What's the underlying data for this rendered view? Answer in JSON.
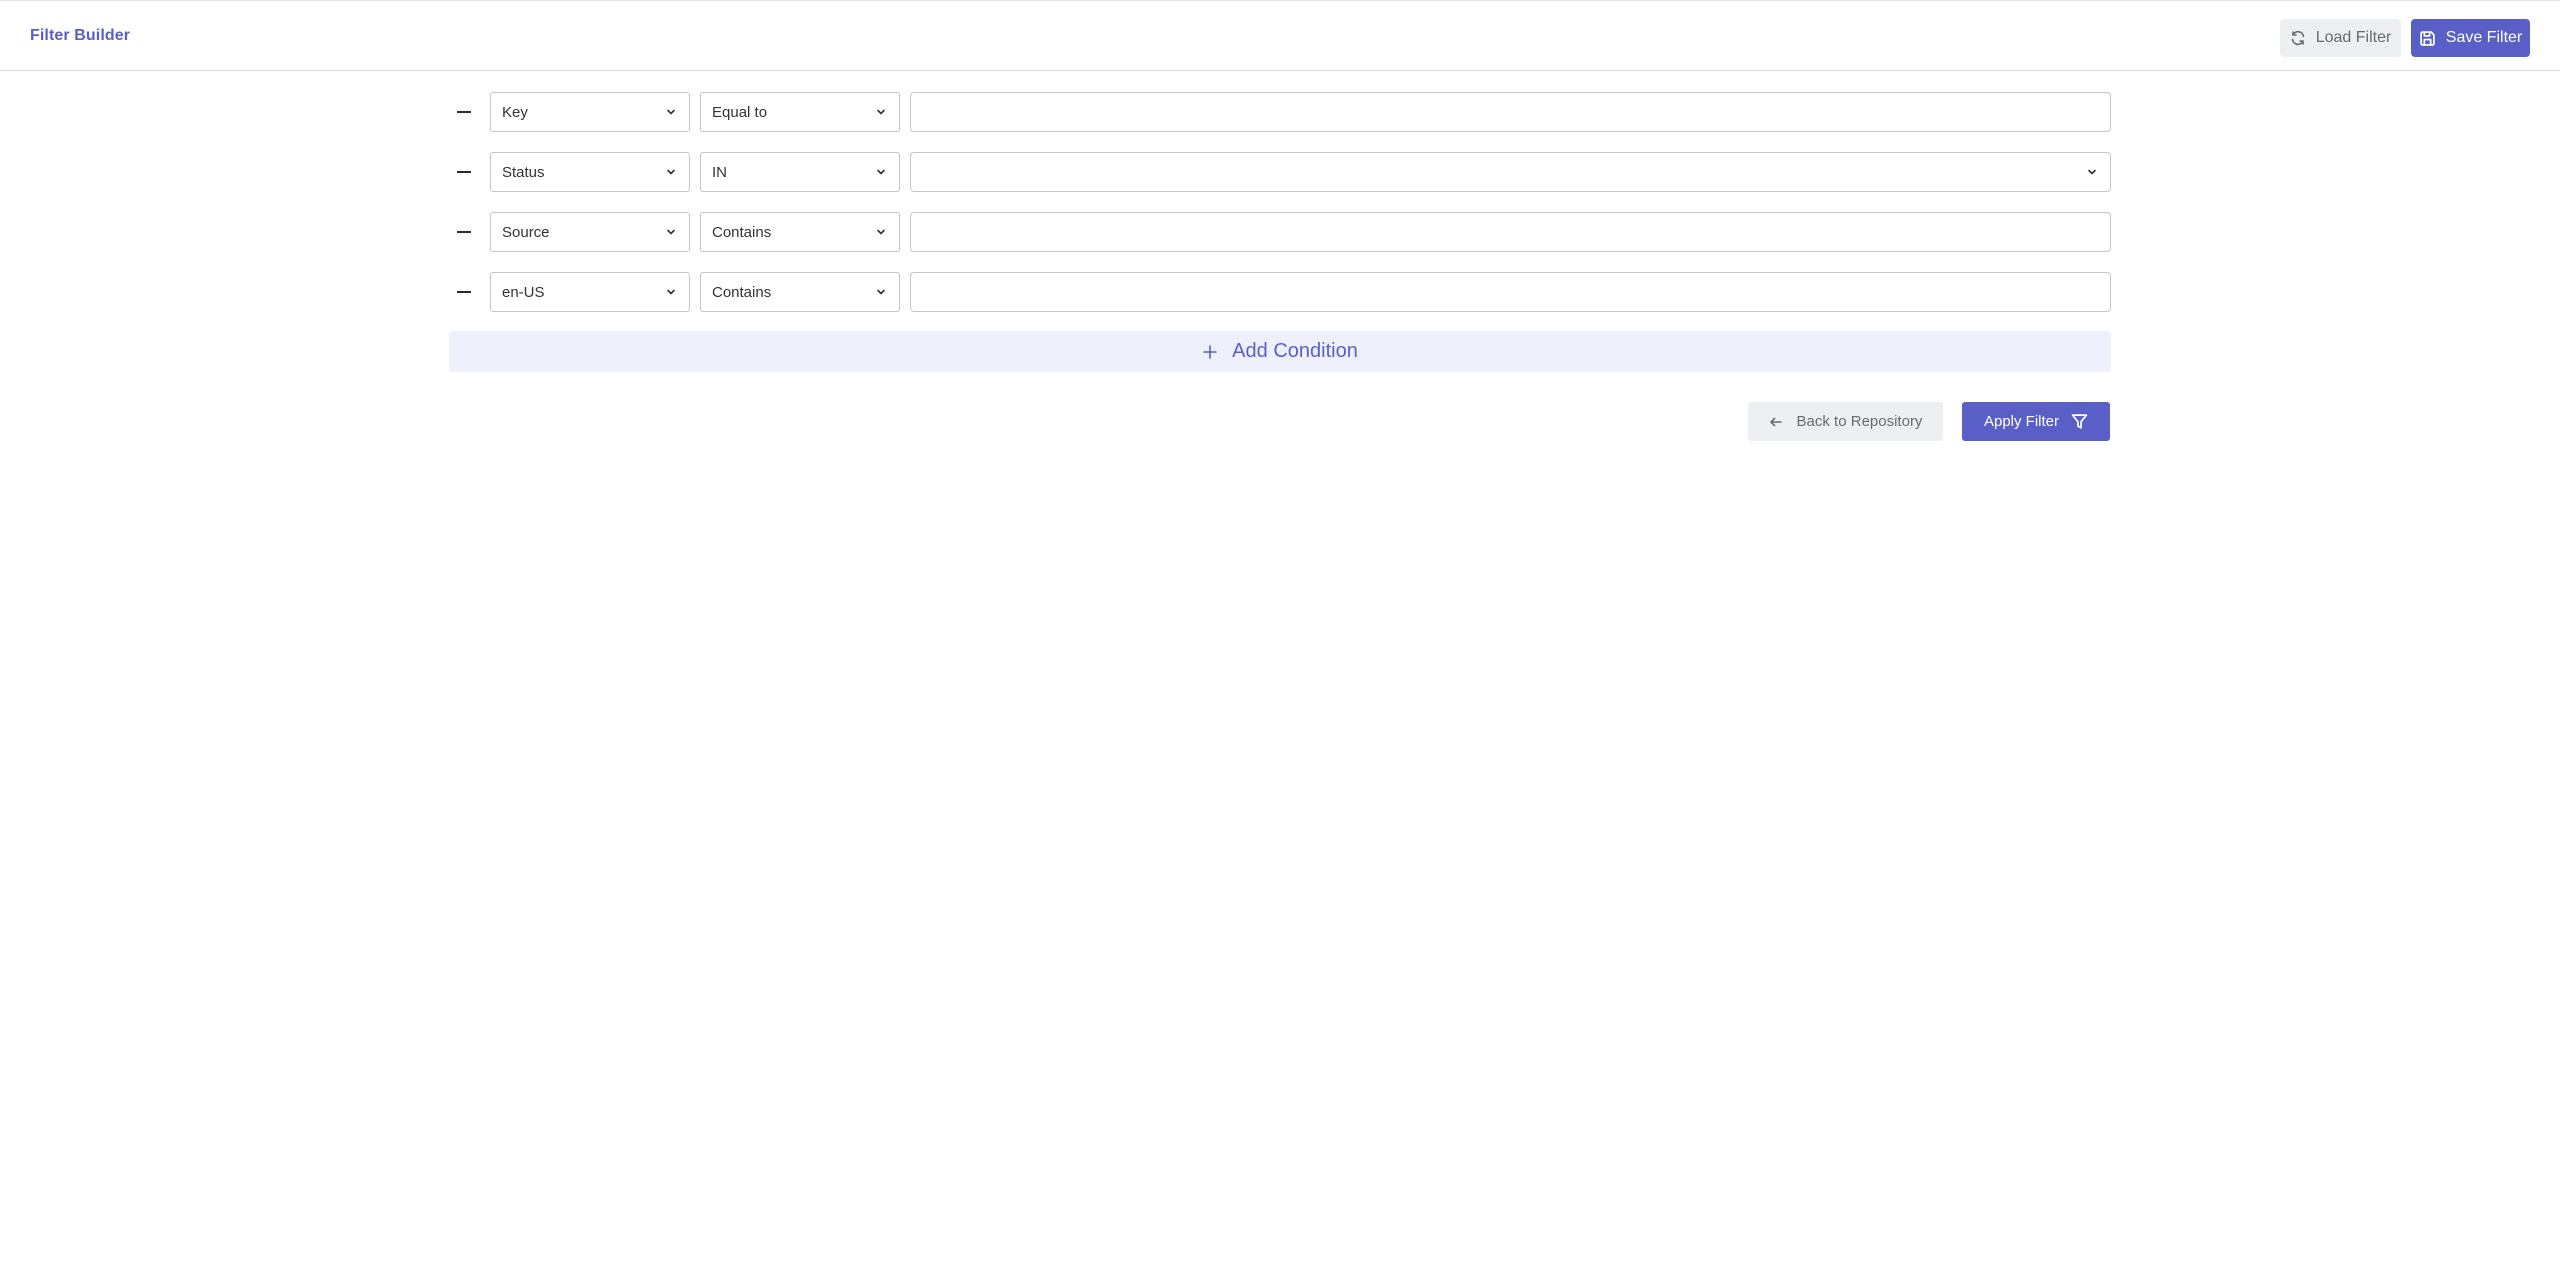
{
  "header": {
    "title": "Filter Builder",
    "load_label": "Load Filter",
    "save_label": "Save Filter"
  },
  "conditions": [
    {
      "field": "Key",
      "operator": "Equal to",
      "value": "",
      "value_type": "text"
    },
    {
      "field": "Status",
      "operator": "IN",
      "value": "",
      "value_type": "select"
    },
    {
      "field": "Source",
      "operator": "Contains",
      "value": "",
      "value_type": "text"
    },
    {
      "field": "en-US",
      "operator": "Contains",
      "value": "",
      "value_type": "text"
    }
  ],
  "add_condition_label": "Add Condition",
  "footer": {
    "back_label": "Back to Repository",
    "apply_label": "Apply Filter"
  },
  "icons": {
    "load": "refresh-icon",
    "save": "floppy-disk-icon",
    "remove": "minus-icon",
    "dropdown": "chevron-down-icon",
    "add": "plus-icon",
    "back": "arrow-left-icon",
    "apply": "funnel-icon"
  },
  "colors": {
    "accent": "#5a5fc8",
    "accent_light": "#eef0fb",
    "secondary_bg": "#eeeff2"
  }
}
